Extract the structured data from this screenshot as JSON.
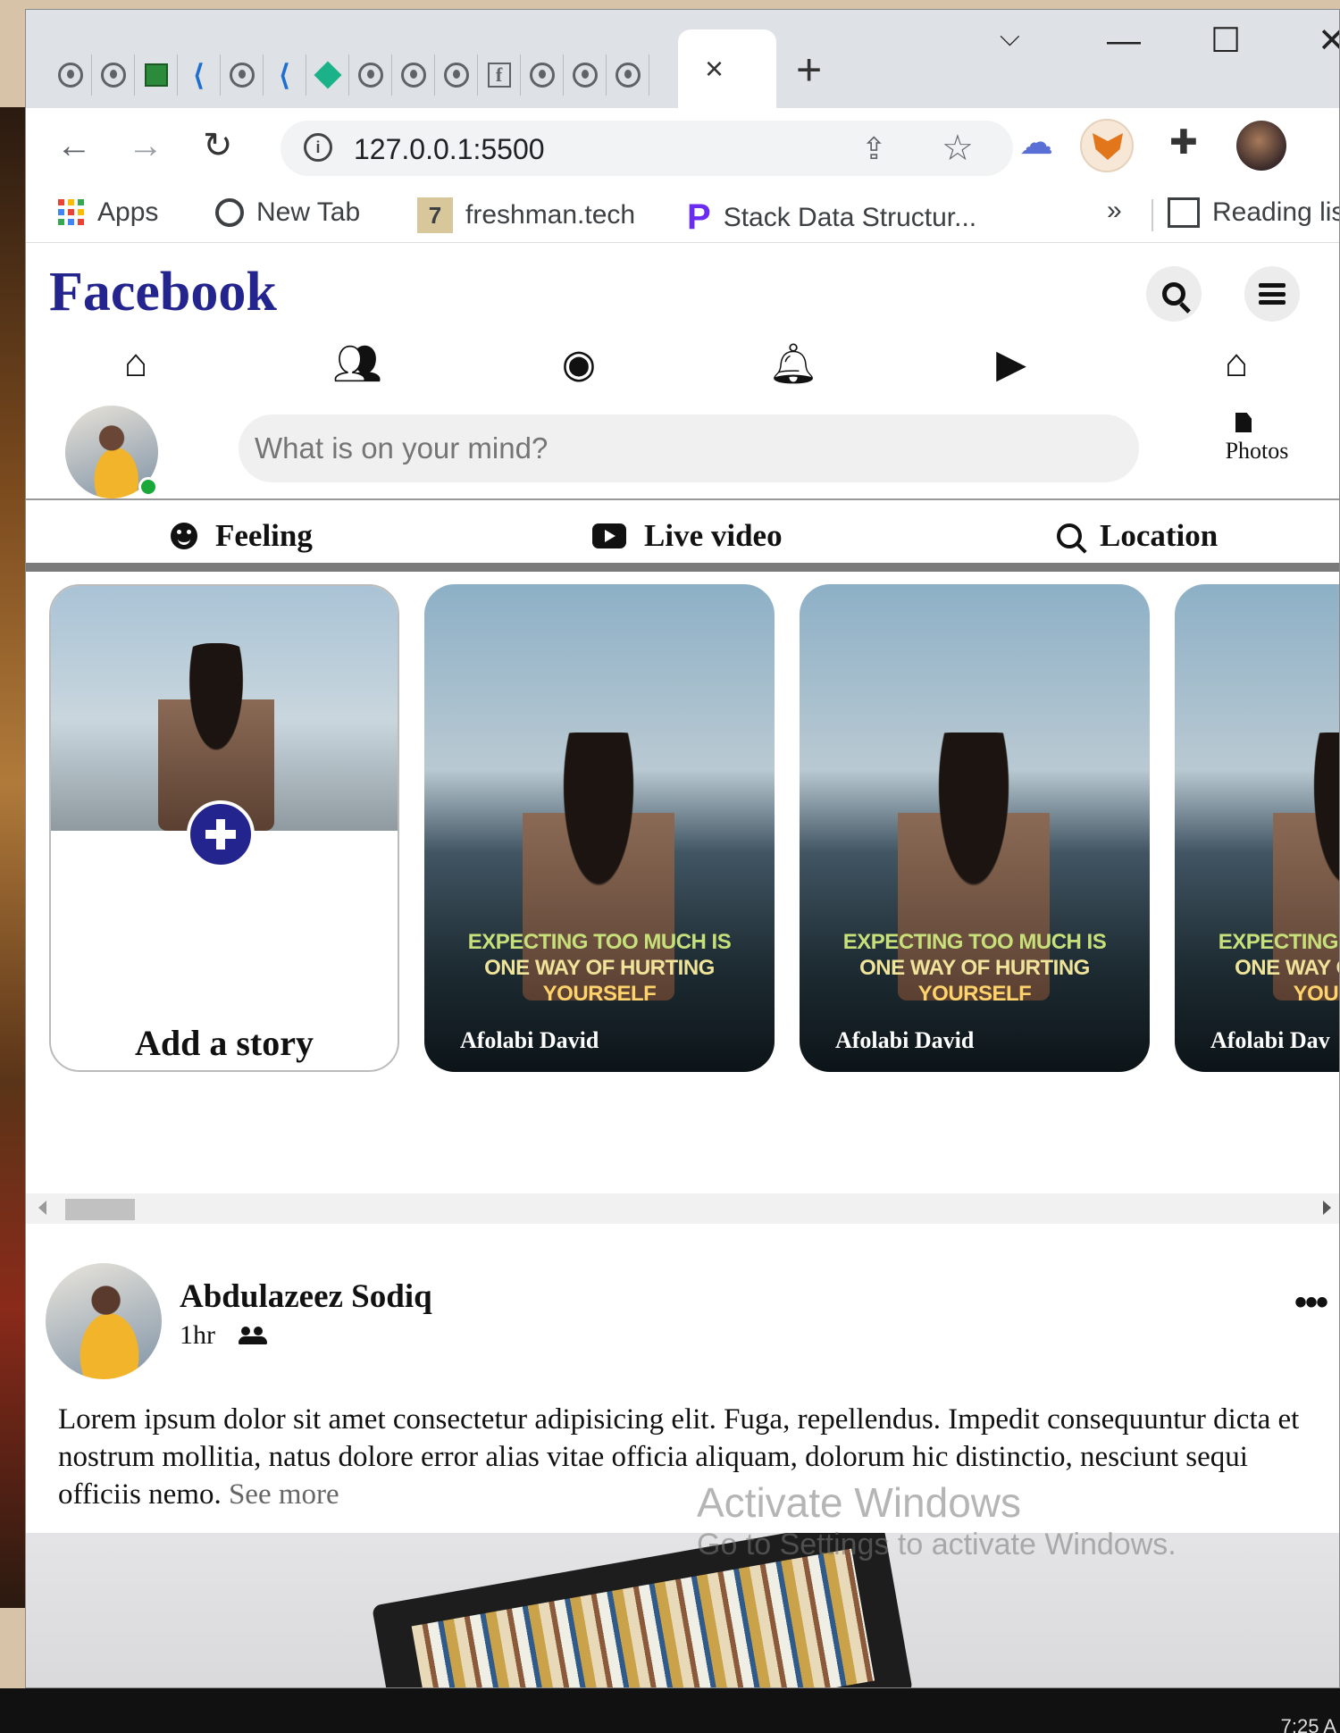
{
  "browser": {
    "active_tab_close": "×",
    "new_tab": "+",
    "window_controls": {
      "dropdown": "⌵",
      "minimize": "—",
      "maximize": "☐",
      "close": "✕"
    },
    "url": "127.0.0.1:5500",
    "bookmarks": [
      {
        "label": "Apps",
        "icon": "apps-grid-icon"
      },
      {
        "label": "New Tab",
        "icon": "globe-icon"
      },
      {
        "label": "freshman.tech",
        "icon": "freshman-icon",
        "glyph": "7"
      },
      {
        "label": "Stack Data Structur...",
        "icon": "stack-icon"
      }
    ],
    "bookmarks_more": "»",
    "reading_list": "Reading lis"
  },
  "fb": {
    "logo": "Facebook",
    "composer": {
      "placeholder": "What is on your mind?",
      "photos_label": "Photos"
    },
    "actions": {
      "feeling": "Feeling",
      "live": "Live video",
      "location": "Location"
    },
    "stories": {
      "add_label": "Add a story",
      "quote_l1": "EXPECTING TOO MUCH IS",
      "quote_l2": "ONE WAY OF HURTING",
      "quote_l3": "YOURSELF",
      "items": [
        {
          "name": "Afolabi David"
        },
        {
          "name": "Afolabi David"
        },
        {
          "name": "Afolabi Dav"
        }
      ]
    },
    "post": {
      "author": "Abdulazeez Sodiq",
      "time": "1hr",
      "more": "•••",
      "body": "Lorem ipsum dolor sit amet consectetur adipisicing elit. Fuga, repellendus. Impedit consequuntur dicta et nostrum mollitia, natus dolore error alias vitae officia aliquam, dolorum hic distinctio, nesciunt sequi officiis nemo.",
      "see_more": "See more"
    }
  },
  "os": {
    "watermark_title": "Activate Windows",
    "watermark_sub": "Go to Settings to activate Windows.",
    "clock": "7:25 A"
  },
  "colors": {
    "fb_blue": "#24248f",
    "online": "#1aa838"
  }
}
